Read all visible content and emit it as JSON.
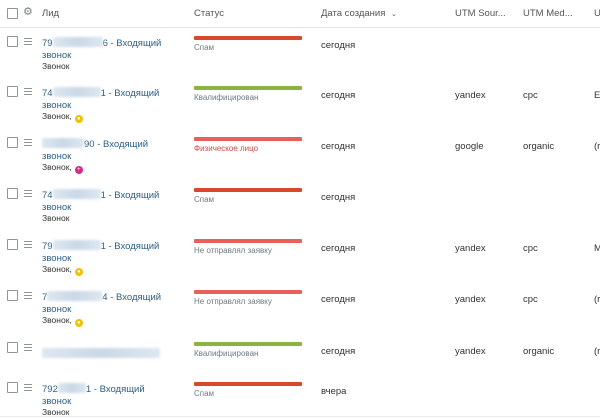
{
  "header": {
    "lead": "Лид",
    "status": "Статус",
    "date": "Дата создания",
    "sort_icon": "chevron-down-icon",
    "utm_source": "UTM Sour...",
    "utm_medium": "UTM Med...",
    "extra": "U"
  },
  "colors": {
    "spam": "#d9482b",
    "qualified": "#8ab33f",
    "physical": "#e8605b",
    "not_sent": "#e8605b",
    "link": "#2b5f86"
  },
  "rows": [
    {
      "lead_prefix": "79",
      "lead_suffix": "6 - Входящий",
      "lead_line2": "звонок",
      "type": "Звонок",
      "badge": "",
      "status": "Спам",
      "date": "сегодня",
      "utm_source": "",
      "utm_medium": "",
      "extra": ""
    },
    {
      "lead_prefix": "74",
      "lead_suffix": "1 - Входящий",
      "lead_line2": "звонок",
      "type": "Звонок,",
      "badge": "yellow",
      "status": "Квалифицирован",
      "date": "сегодня",
      "utm_source": "yandex",
      "utm_medium": "cpc",
      "extra": "E"
    },
    {
      "lead_prefix": "",
      "lead_suffix": "90 - Входящий",
      "lead_line2": "звонок",
      "type": "Звонок,",
      "badge": "pink",
      "status": "Физическое лицо",
      "date": "сегодня",
      "utm_source": "google",
      "utm_medium": "organic",
      "extra": "(r"
    },
    {
      "lead_prefix": "74",
      "lead_suffix": "1 - Входящий",
      "lead_line2": "звонок",
      "type": "Звонок",
      "badge": "",
      "status": "Спам",
      "date": "сегодня",
      "utm_source": "",
      "utm_medium": "",
      "extra": ""
    },
    {
      "lead_prefix": "79",
      "lead_suffix": "1 - Входящий",
      "lead_line2": "звонок",
      "type": "Звонок,",
      "badge": "yellow",
      "status": "Не отправлял заявку",
      "date": "сегодня",
      "utm_source": "yandex",
      "utm_medium": "cpc",
      "extra": "M"
    },
    {
      "lead_prefix": "7",
      "lead_suffix": "4 - Входящий",
      "lead_line2": "звонок",
      "type": "Звонок,",
      "badge": "yellow",
      "status": "Не отправлял заявку",
      "date": "сегодня",
      "utm_source": "yandex",
      "utm_medium": "cpc",
      "extra": "(r"
    },
    {
      "lead_prefix": "",
      "lead_suffix": "",
      "lead_line2": "",
      "type": "",
      "badge": "",
      "status": "Квалифицирован",
      "date": "сегодня",
      "utm_source": "yandex",
      "utm_medium": "organic",
      "extra": "(r"
    },
    {
      "lead_prefix": "792",
      "lead_suffix": "1 - Входящий",
      "lead_line2": "звонок",
      "type": "Звонок",
      "badge": "",
      "status": "Спам",
      "date": "вчера",
      "utm_source": "",
      "utm_medium": "",
      "extra": ""
    }
  ]
}
